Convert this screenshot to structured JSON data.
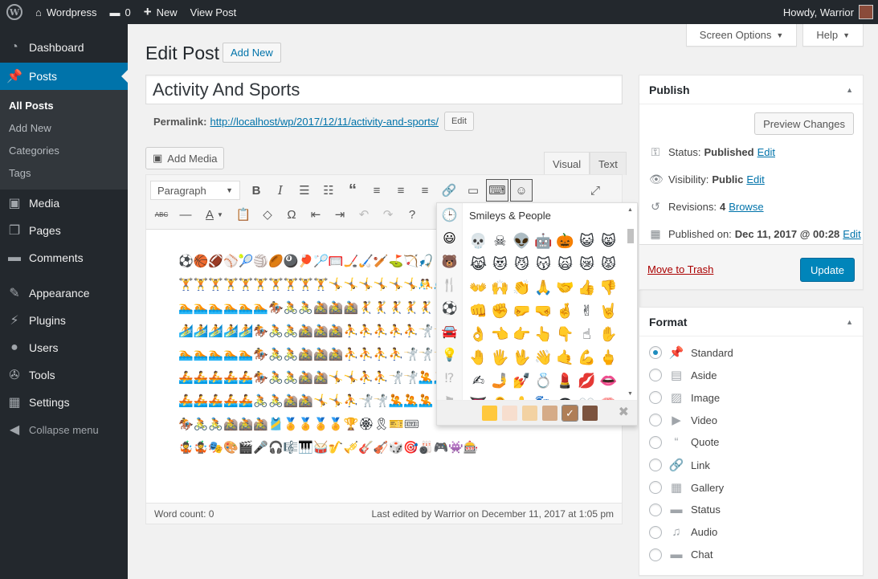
{
  "adminbar": {
    "site_name": "Wordpress",
    "comments_count": "0",
    "new_label": "New",
    "view_post_label": "View Post",
    "howdy": "Howdy, Warrior"
  },
  "sidebar": {
    "items": [
      {
        "label": "Dashboard",
        "icon": "dashboard-icon"
      },
      {
        "label": "Posts",
        "icon": "pin-icon"
      },
      {
        "label": "Media",
        "icon": "media-icon"
      },
      {
        "label": "Pages",
        "icon": "pages-icon"
      },
      {
        "label": "Comments",
        "icon": "comments-icon"
      },
      {
        "label": "Appearance",
        "icon": "brush-icon"
      },
      {
        "label": "Plugins",
        "icon": "plug-icon"
      },
      {
        "label": "Users",
        "icon": "users-icon"
      },
      {
        "label": "Tools",
        "icon": "wrench-icon"
      },
      {
        "label": "Settings",
        "icon": "settings-icon"
      }
    ],
    "posts_submenu": [
      "All Posts",
      "Add New",
      "Categories",
      "Tags"
    ],
    "collapse_label": "Collapse menu",
    "active_color": "#0073aa"
  },
  "screen_meta": {
    "screen_options": "Screen Options",
    "help": "Help"
  },
  "page": {
    "title": "Edit Post",
    "add_new": "Add New",
    "post_title": "Activity And Sports",
    "permalink_label": "Permalink:",
    "permalink_url": "http://localhost/wp/2017/12/11/activity-and-sports/",
    "permalink_edit": "Edit",
    "add_media": "Add Media"
  },
  "editor": {
    "tabs": {
      "visual": "Visual",
      "text": "Text"
    },
    "format_value": "Paragraph",
    "content_lines": [
      "⚽🏀🏈⚾🎾🏐🏉🎱🏓🏸🥅🏒🏑🏏⛳🏹🎣",
      "🏋🏋🏋🏋🏋🏋🏋🏋🏋🏋🤸🤸🤸🤸🤸🤸🤼🤼🤼🤼🤼🤼",
      "🏊🏊🏊🏊🏊🏊🏇🚴🚴🚵🚵🚵🤾🤾🤾🤾🤾🤾",
      "🏄🏄🏄🏄🏄🏇🚴🚴🚵🚵🚵⛹⛹⛹⛹⛹🤺🤺",
      "🏊🏊🏊🏊🏊🏇🚴🚴🚵🚵🚵⛹⛹⛹⛹🤺🤺🤺",
      "🚣🚣🚣🚣🚣🏇🚴🚴🚵🚵🤸🤸⛹⛹🤺🤺🤽🤽",
      "🚣🚣🚣🚣🚣🚴🚴🚵🚵🤸🤸⛹🤺🤺🤽🤽🤽",
      "🏇🚴🚴🚵🚵🚵🎽🏅🏅🏅🏅🏆🏵🎗🎫🎟",
      "🤹🤹🎭🎨🎬🎤🎧🎼🎹🥁🎷🎺🎸🎻🎲🎯🎳🎮👾🎰"
    ],
    "word_count": "Word count: 0",
    "last_edited": "Last edited by Warrior on December 11, 2017 at 1:05 pm"
  },
  "emoji_picker": {
    "heading": "Smileys & People",
    "categories": [
      "recent-icon",
      "smiley-icon",
      "animal-icon",
      "food-icon",
      "activity-icon",
      "travel-icon",
      "object-icon",
      "symbol-icon",
      "flag-icon"
    ],
    "grid": [
      "💀",
      "☠",
      "👽",
      "🤖",
      "🎃",
      "😺",
      "😸",
      "😹",
      "😻",
      "😼",
      "😽",
      "🙀",
      "😿",
      "😾",
      "👐",
      "🙌",
      "👏",
      "🙏",
      "🤝",
      "👍",
      "👎",
      "👊",
      "✊",
      "🤛",
      "🤜",
      "🤞",
      "✌",
      "🤘",
      "👌",
      "👈",
      "👉",
      "👆",
      "👇",
      "☝",
      "✋",
      "🤚",
      "🖐",
      "🖖",
      "👋",
      "🤙",
      "💪",
      "🖕",
      "✍",
      "🤳",
      "💅",
      "💍",
      "💄",
      "💋",
      "👄",
      "👅",
      "👂",
      "👃",
      "👣",
      "👁",
      "👀",
      "🧠"
    ],
    "tones": [
      "#ffc83d",
      "#f7dece",
      "#f3d2a2",
      "#d5ab88",
      "#af7e57",
      "#7c533e"
    ],
    "selected_tone": 4
  },
  "publish": {
    "title": "Publish",
    "preview": "Preview Changes",
    "status_label": "Status:",
    "status_value": "Published",
    "visibility_label": "Visibility:",
    "visibility_value": "Public",
    "revisions_label": "Revisions:",
    "revisions_value": "4",
    "browse": "Browse",
    "published_label": "Published on:",
    "published_value": "Dec 11, 2017 @ 00:28",
    "edit": "Edit",
    "trash": "Move to Trash",
    "update": "Update"
  },
  "format": {
    "title": "Format",
    "options": [
      {
        "label": "Standard",
        "icon": "pin-icon"
      },
      {
        "label": "Aside",
        "icon": "aside-icon"
      },
      {
        "label": "Image",
        "icon": "image-icon"
      },
      {
        "label": "Video",
        "icon": "video-icon"
      },
      {
        "label": "Quote",
        "icon": "quote-icon"
      },
      {
        "label": "Link",
        "icon": "link-icon"
      },
      {
        "label": "Gallery",
        "icon": "gallery-icon"
      },
      {
        "label": "Status",
        "icon": "status-icon"
      },
      {
        "label": "Audio",
        "icon": "audio-icon"
      },
      {
        "label": "Chat",
        "icon": "chat-icon"
      }
    ],
    "selected": 0
  }
}
